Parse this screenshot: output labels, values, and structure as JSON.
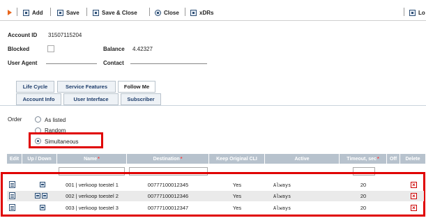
{
  "toolbar": {
    "add": "Add",
    "save": "Save",
    "save_close": "Save & Close",
    "close": "Close",
    "xdrs": "xDRs",
    "logout": "Lo"
  },
  "account": {
    "id_label": "Account ID",
    "id_value": "31507115204",
    "blocked_label": "Blocked",
    "balance_label": "Balance",
    "balance_value": "4.42327",
    "user_agent_label": "User Agent",
    "contact_label": "Contact"
  },
  "tabs": {
    "row1": [
      "Life Cycle",
      "Service Features",
      "Follow Me"
    ],
    "row2": [
      "Account Info",
      "User Interface",
      "Subscriber"
    ]
  },
  "order": {
    "label": "Order",
    "options": [
      "As listed",
      "Random",
      "Simultaneous"
    ],
    "selected": "Simultaneous"
  },
  "table": {
    "headers": {
      "edit": "Edit",
      "updown": "Up / Down",
      "name": "Name",
      "destination": "Destination",
      "keep_cli": "Keep Original CLI",
      "active": "Active",
      "timeout": "Timeout, sec",
      "off": "Off",
      "delete": "Delete"
    },
    "rows": [
      {
        "name": "001 | verkoop toestel 1",
        "destination": "00777100012345",
        "keep_cli": "Yes",
        "active": "Always",
        "timeout": "20"
      },
      {
        "name": "002 | verkoop toestel 2",
        "destination": "00777100012346",
        "keep_cli": "Yes",
        "active": "Always",
        "timeout": "20"
      },
      {
        "name": "003 | verkoop toestel 3",
        "destination": "00777100012347",
        "keep_cli": "Yes",
        "active": "Always",
        "timeout": "20"
      }
    ]
  },
  "colors": {
    "accent_orange": "#e8651b",
    "highlight_red": "#e00000",
    "header_bg": "#b7c2cd",
    "tab_text": "#1e3d6b"
  }
}
